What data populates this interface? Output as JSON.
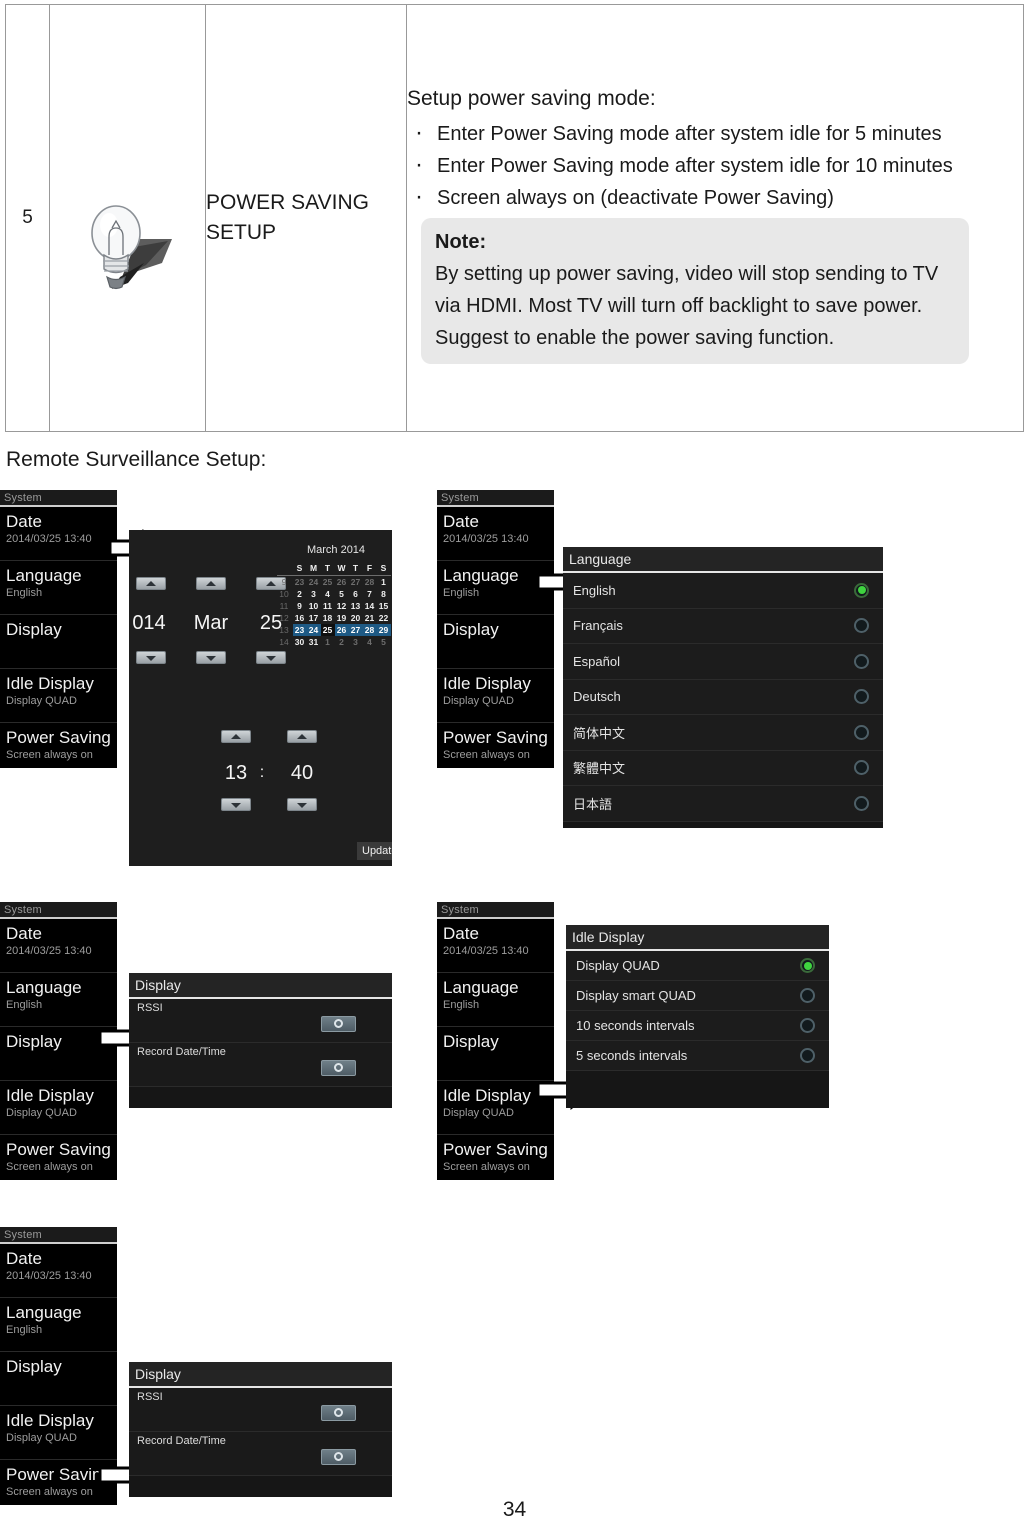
{
  "table": {
    "row_number": "5",
    "icon_name": "lightbulb-icon",
    "feature_title": "POWER SAVING SETUP",
    "description_heading": "Setup power saving mode:",
    "bullets": [
      "Enter Power Saving mode after system idle for 5 minutes",
      "Enter Power Saving mode after system idle for 10 minutes",
      "Screen always on (deactivate Power Saving)"
    ],
    "note": {
      "title": "Note:",
      "lines": [
        "By setting up power saving, video will stop sending to TV via HDMI. Most TV will turn off backlight to save power.",
        "Suggest to enable the power saving function."
      ]
    }
  },
  "section_caption": "Remote Surveillance Setup:",
  "system_menu": {
    "title": "System",
    "items": [
      {
        "label": "Date",
        "value": "2014/03/25 13:40"
      },
      {
        "label": "Language",
        "value": "English"
      },
      {
        "label": "Display",
        "value": ""
      },
      {
        "label": "Idle Display",
        "value": "Display QUAD"
      },
      {
        "label": "Power Saving",
        "value": "Screen always on"
      }
    ]
  },
  "date_picker": {
    "year": "014",
    "month": "Mar",
    "day": "25",
    "hour": "13",
    "separator": ":",
    "minute": "40",
    "calendar_title": "March 2014",
    "day_of_week": [
      "S",
      "M",
      "T",
      "W",
      "T",
      "F",
      "S"
    ],
    "weeks": [
      {
        "week": "9",
        "days": [
          "23",
          "24",
          "25",
          "26",
          "27",
          "28",
          "1"
        ],
        "dim": [
          true,
          true,
          true,
          true,
          true,
          true,
          false
        ]
      },
      {
        "week": "10",
        "days": [
          "2",
          "3",
          "4",
          "5",
          "6",
          "7",
          "8"
        ],
        "dim": [
          false,
          false,
          false,
          false,
          false,
          false,
          false
        ]
      },
      {
        "week": "11",
        "days": [
          "9",
          "10",
          "11",
          "12",
          "13",
          "14",
          "15"
        ],
        "dim": [
          false,
          false,
          false,
          false,
          false,
          false,
          false
        ]
      },
      {
        "week": "12",
        "days": [
          "16",
          "17",
          "18",
          "19",
          "20",
          "21",
          "22"
        ],
        "dim": [
          false,
          false,
          false,
          false,
          false,
          false,
          false
        ]
      },
      {
        "week": "13",
        "days": [
          "23",
          "24",
          "25",
          "26",
          "27",
          "28",
          "29"
        ],
        "dim": [
          false,
          false,
          false,
          false,
          false,
          false,
          false
        ]
      },
      {
        "week": "14",
        "days": [
          "30",
          "31",
          "1",
          "2",
          "3",
          "4",
          "5"
        ],
        "dim": [
          false,
          false,
          true,
          true,
          true,
          true,
          true
        ]
      }
    ],
    "selected_day": "25",
    "update_label": "Update"
  },
  "language_panel": {
    "title": "Language",
    "options": [
      {
        "label": "English",
        "selected": true
      },
      {
        "label": "Français",
        "selected": false
      },
      {
        "label": "Español",
        "selected": false
      },
      {
        "label": "Deutsch",
        "selected": false
      },
      {
        "label": "简体中文",
        "selected": false
      },
      {
        "label": "繁體中文",
        "selected": false
      },
      {
        "label": "日本語",
        "selected": false
      }
    ]
  },
  "display_panel": {
    "title": "Display",
    "switches": [
      {
        "label": "RSSI"
      },
      {
        "label": "Record Date/Time"
      }
    ]
  },
  "idle_display_panel": {
    "title": "Idle Display",
    "options": [
      {
        "label": "Display QUAD",
        "selected": true
      },
      {
        "label": "Display smart QUAD",
        "selected": false
      },
      {
        "label": "10 seconds intervals",
        "selected": false
      },
      {
        "label": "5 seconds intervals",
        "selected": false
      }
    ]
  },
  "colors": {
    "radio_on": "#3fd43f",
    "calendar_selection": "#1e5a85",
    "note_background": "#e8e8e8"
  },
  "page_number": "34"
}
